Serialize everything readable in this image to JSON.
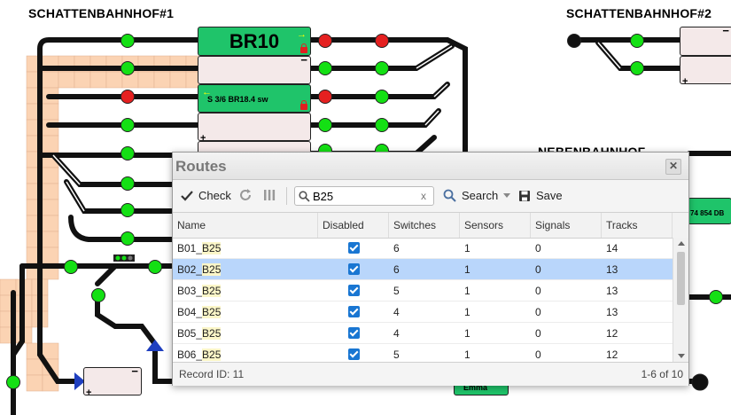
{
  "layout": {
    "station_left": "SCHATTENBAHNHOF#1",
    "station_right": "SCHATTENBAHNHOF#2",
    "station_mid": "NEBENBAHNHOF",
    "block_br10": "BR10",
    "block_s36": "S 3/6 BR18.4 sw",
    "block_right": "74 854 DB",
    "block_bottom": "Emma",
    "minus": "−",
    "plus": "+",
    "arrow_right": "→",
    "arrow_left": "←",
    "colors": {
      "track": "#111111",
      "green": "#14e014",
      "red": "#e52020",
      "block_occupied": "#1fc46a",
      "block_free": "#f4e9e9",
      "tile": "#fbd3b3"
    }
  },
  "dialog": {
    "title": "Routes",
    "close_icon": "close-icon",
    "toolbar": {
      "check": "Check",
      "search_value": "B25",
      "search": "Search",
      "save": "Save"
    },
    "columns": [
      "Name",
      "Disabled",
      "Switches",
      "Sensors",
      "Signals",
      "Tracks"
    ],
    "rows": [
      {
        "name_prefix": "B01_",
        "name_hl": "B25",
        "switches": "6",
        "sensors": "1",
        "signals": "0",
        "tracks": "14"
      },
      {
        "name_prefix": "B02_",
        "name_hl": "B25",
        "switches": "6",
        "sensors": "1",
        "signals": "0",
        "tracks": "13"
      },
      {
        "name_prefix": "B03_",
        "name_hl": "B25",
        "switches": "5",
        "sensors": "1",
        "signals": "0",
        "tracks": "13"
      },
      {
        "name_prefix": "B04_",
        "name_hl": "B25",
        "switches": "4",
        "sensors": "1",
        "signals": "0",
        "tracks": "13"
      },
      {
        "name_prefix": "B05_",
        "name_hl": "B25",
        "switches": "4",
        "sensors": "1",
        "signals": "0",
        "tracks": "12"
      },
      {
        "name_prefix": "B06_",
        "name_hl": "B25",
        "switches": "5",
        "sensors": "1",
        "signals": "0",
        "tracks": "12"
      }
    ],
    "footer": {
      "record": "Record ID: 11",
      "range": "1-6 of 10"
    }
  }
}
